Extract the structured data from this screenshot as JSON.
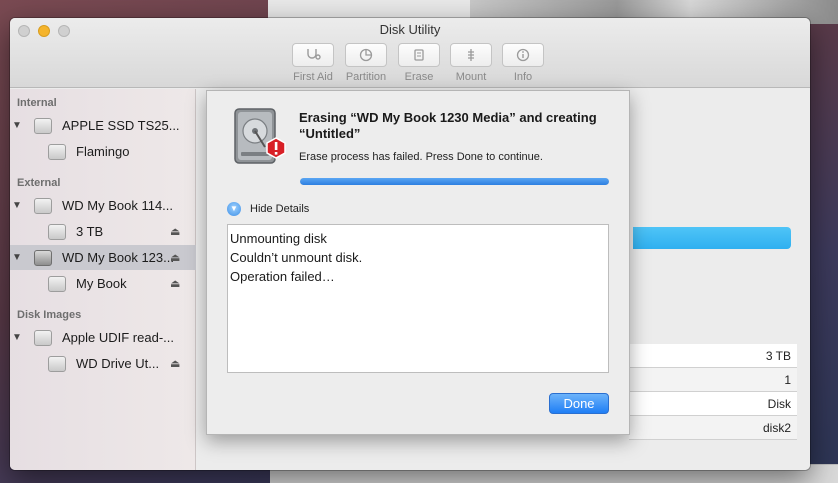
{
  "window": {
    "title": "Disk Utility"
  },
  "toolbar": {
    "items": [
      {
        "label": "First Aid",
        "icon": "stethoscope-icon"
      },
      {
        "label": "Partition",
        "icon": "pie-icon"
      },
      {
        "label": "Erase",
        "icon": "eraser-icon"
      },
      {
        "label": "Mount",
        "icon": "mount-icon"
      },
      {
        "label": "Info",
        "icon": "info-icon"
      }
    ]
  },
  "sidebar": {
    "sections": [
      {
        "title": "Internal"
      },
      {
        "title": "External"
      },
      {
        "title": "Disk Images"
      }
    ],
    "items": [
      {
        "label": "APPLE SSD TS25...",
        "level": 0,
        "eject": false
      },
      {
        "label": "Flamingo",
        "level": 1,
        "eject": false
      },
      {
        "label": "WD My Book 114...",
        "level": 0,
        "eject": true
      },
      {
        "label": "3 TB",
        "level": 1,
        "eject": true
      },
      {
        "label": "WD My Book 123...",
        "level": 0,
        "eject": true,
        "selected": true
      },
      {
        "label": "My Book",
        "level": 1,
        "eject": true
      },
      {
        "label": "Apple UDIF read-...",
        "level": 0,
        "eject": false
      },
      {
        "label": "WD Drive Ut...",
        "level": 1,
        "eject": true
      }
    ]
  },
  "info_values": [
    "3 TB",
    "1",
    "Disk",
    "disk2"
  ],
  "sheet": {
    "title": "Erasing “WD My Book 1230 Media” and creating “Untitled”",
    "message": "Erase process has failed. Press Done to continue.",
    "progress": 1.0,
    "details_toggle_label": "Hide Details",
    "details_lines": [
      "Unmounting disk",
      "Couldn’t unmount disk.",
      "Operation failed…"
    ],
    "done_label": "Done"
  },
  "colors": {
    "accent": "#2d7fe0",
    "alert": "#d81f26",
    "selection": "#c9c9cf"
  }
}
